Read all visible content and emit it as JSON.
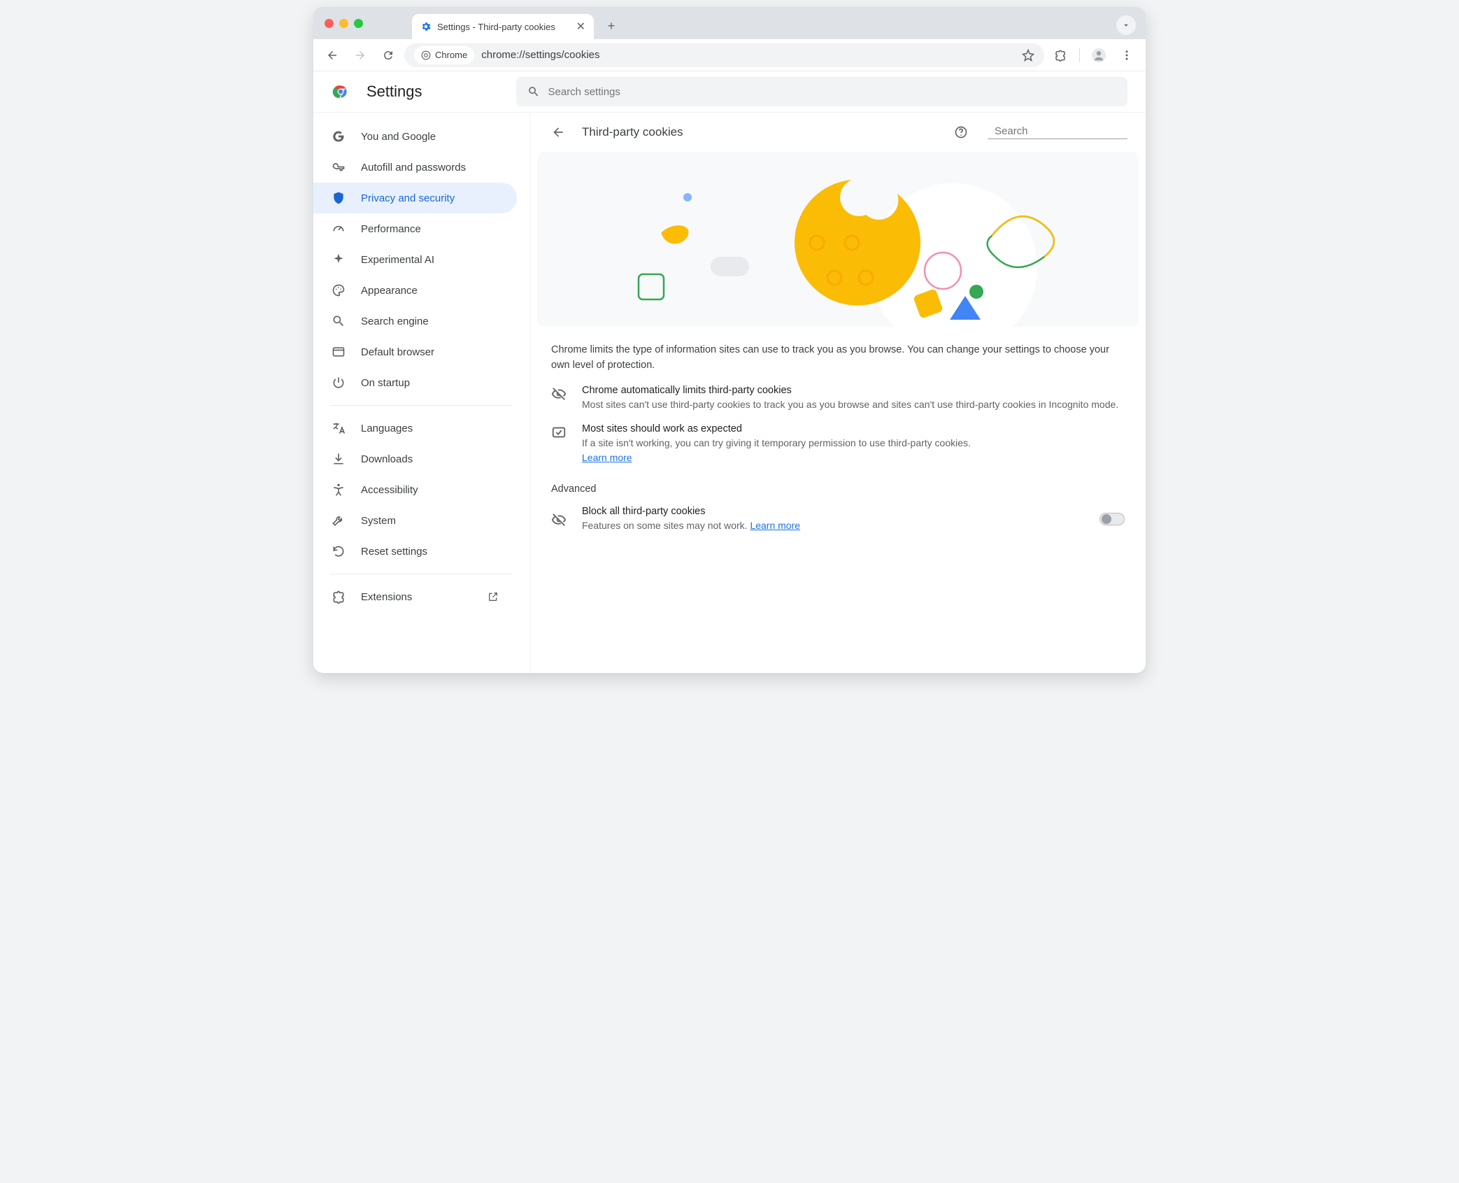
{
  "tab": {
    "title": "Settings - Third-party cookies"
  },
  "omnibox": {
    "chip": "Chrome",
    "url": "chrome://settings/cookies"
  },
  "header": {
    "title": "Settings",
    "search_placeholder": "Search settings"
  },
  "sidebar": {
    "items": [
      {
        "label": "You and Google"
      },
      {
        "label": "Autofill and passwords"
      },
      {
        "label": "Privacy and security"
      },
      {
        "label": "Performance"
      },
      {
        "label": "Experimental AI"
      },
      {
        "label": "Appearance"
      },
      {
        "label": "Search engine"
      },
      {
        "label": "Default browser"
      },
      {
        "label": "On startup"
      }
    ],
    "items2": [
      {
        "label": "Languages"
      },
      {
        "label": "Downloads"
      },
      {
        "label": "Accessibility"
      },
      {
        "label": "System"
      },
      {
        "label": "Reset settings"
      }
    ],
    "items3": [
      {
        "label": "Extensions"
      }
    ]
  },
  "page": {
    "title": "Third-party cookies",
    "search_placeholder": "Search",
    "intro": "Chrome limits the type of information sites can use to track you as you browse. You can change your settings to choose your own level of protection.",
    "info1": {
      "title": "Chrome automatically limits third-party cookies",
      "sub": "Most sites can't use third-party cookies to track you as you browse and sites can't use third-party cookies in Incognito mode."
    },
    "info2": {
      "title": "Most sites should work as expected",
      "sub": "If a site isn't working, you can try giving it temporary permission to use third-party cookies.",
      "learn": "Learn more"
    },
    "advanced_label": "Advanced",
    "block": {
      "title": "Block all third-party cookies",
      "sub": "Features on some sites may not work.",
      "learn": "Learn more"
    }
  }
}
